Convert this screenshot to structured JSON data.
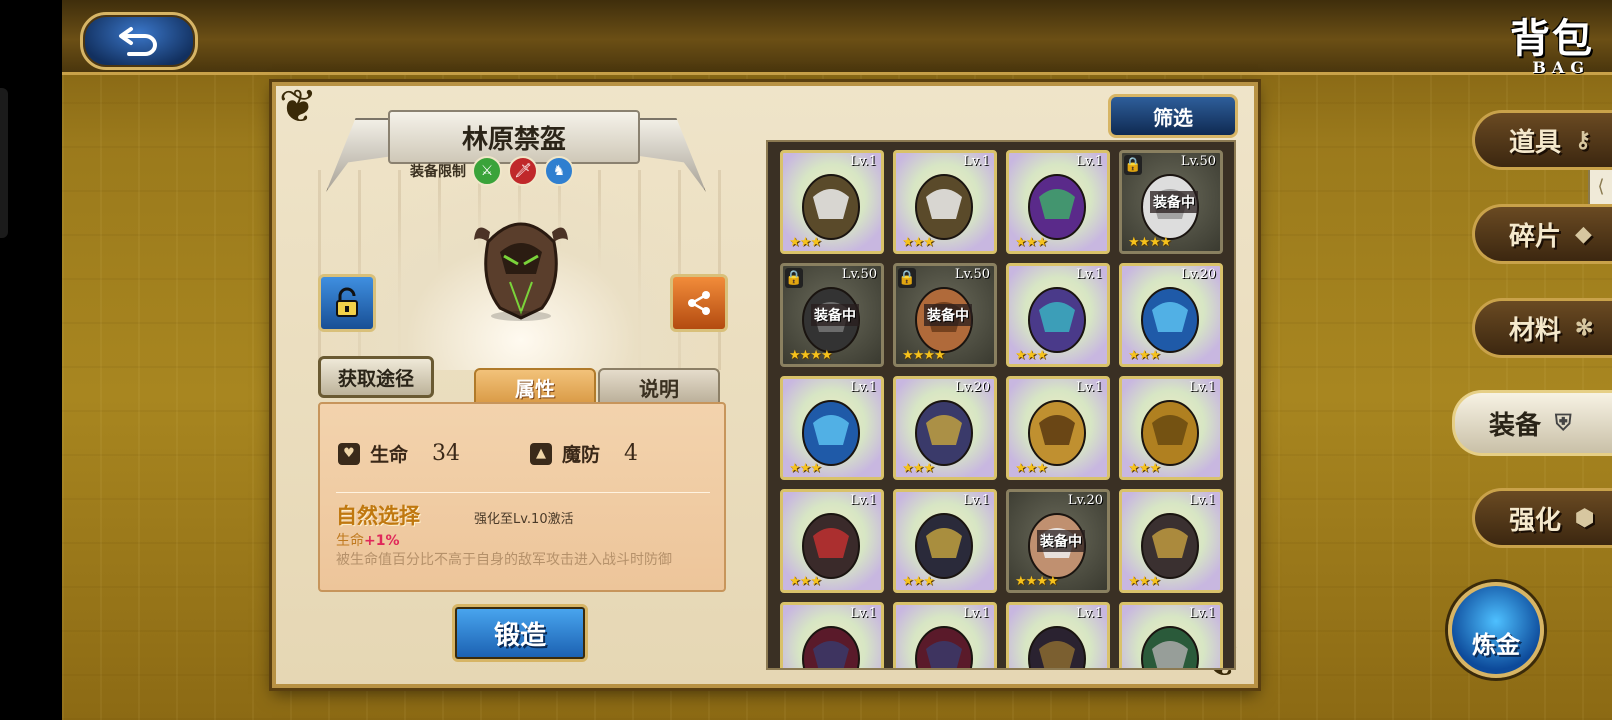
{
  "header": {
    "title_cn": "背包",
    "title_en": "BAG"
  },
  "item": {
    "name": "林原禁盔",
    "restrict_label": "装备限制",
    "restrict_icons": [
      "sword-class-icon",
      "warrior-class-icon",
      "rider-class-icon"
    ],
    "source_label": "获取途径",
    "tabs": [
      "属性",
      "说明"
    ],
    "stats": [
      {
        "icon": "heart-icon",
        "label": "生命",
        "value": "34"
      },
      {
        "icon": "wizard-hat-icon",
        "label": "魔防",
        "value": "4"
      }
    ],
    "skill": {
      "name": "自然选择",
      "condition": "强化至Lv.10激活",
      "bonus_label": "生命",
      "bonus_value": "+1%",
      "description": "被生命值百分比不高于自身的敌军攻击进入战斗时防御"
    },
    "forge_label": "锻造"
  },
  "filter_label": "筛选",
  "equip_tag": "装备中",
  "grid": [
    {
      "lv": "Lv.1",
      "art": "skull-helm",
      "stars": 3,
      "equipped": false,
      "locked": false
    },
    {
      "lv": "Lv.1",
      "art": "skull-helm",
      "stars": 3,
      "equipped": false,
      "locked": false
    },
    {
      "lv": "Lv.1",
      "art": "purple-cape",
      "stars": 3,
      "equipped": false,
      "locked": false
    },
    {
      "lv": "Lv.50",
      "art": "hero-white",
      "stars": 4,
      "equipped": true,
      "locked": true
    },
    {
      "lv": "Lv.50",
      "art": "hero-dark",
      "stars": 4,
      "equipped": true,
      "locked": true
    },
    {
      "lv": "Lv.50",
      "art": "hero-brown",
      "stars": 4,
      "equipped": true,
      "locked": true
    },
    {
      "lv": "Lv.1",
      "art": "mage-armor",
      "stars": 3,
      "equipped": false,
      "locked": false
    },
    {
      "lv": "Lv.20",
      "art": "blue-armor",
      "stars": 3,
      "equipped": false,
      "locked": false
    },
    {
      "lv": "Lv.1",
      "art": "blue-armor",
      "stars": 3,
      "equipped": false,
      "locked": false
    },
    {
      "lv": "Lv.20",
      "art": "knight-armor",
      "stars": 3,
      "equipped": false,
      "locked": false
    },
    {
      "lv": "Lv.1",
      "art": "golden-axe",
      "stars": 3,
      "equipped": false,
      "locked": false
    },
    {
      "lv": "Lv.1",
      "art": "amulet",
      "stars": 3,
      "equipped": false,
      "locked": false
    },
    {
      "lv": "Lv.1",
      "art": "dragon-ring",
      "stars": 3,
      "equipped": false,
      "locked": false
    },
    {
      "lv": "Lv.1",
      "art": "dark-helm",
      "stars": 3,
      "equipped": false,
      "locked": false
    },
    {
      "lv": "Lv.20",
      "art": "hero-old",
      "stars": 4,
      "equipped": true,
      "locked": false
    },
    {
      "lv": "Lv.1",
      "art": "gold-armor",
      "stars": 3,
      "equipped": false,
      "locked": false
    },
    {
      "lv": "Lv.1",
      "art": "red-armor",
      "stars": 3,
      "equipped": false,
      "locked": false
    },
    {
      "lv": "Lv.1",
      "art": "red-armor",
      "stars": 3,
      "equipped": false,
      "locked": false
    },
    {
      "lv": "Lv.1",
      "art": "dark-armor",
      "stars": 3,
      "equipped": false,
      "locked": false
    },
    {
      "lv": "Lv.1",
      "art": "scythe",
      "stars": 3,
      "equipped": false,
      "locked": false
    }
  ],
  "side_tabs": [
    {
      "label": "道具",
      "icon": "key-icon",
      "active": false
    },
    {
      "label": "碎片",
      "icon": "shard-icon",
      "active": false
    },
    {
      "label": "材料",
      "icon": "gear-icon",
      "active": false
    },
    {
      "label": "装备",
      "icon": "armor-icon",
      "active": true
    },
    {
      "label": "强化",
      "icon": "upgrade-icon",
      "active": false
    }
  ],
  "alchemy_label": "炼金",
  "colors": {
    "gold_frame": "#d7b565",
    "panel_bg": "#efe4c9",
    "button_blue": "#1a5fb0",
    "skill_orange": "#c0780f",
    "bonus_red": "#e0285a"
  }
}
